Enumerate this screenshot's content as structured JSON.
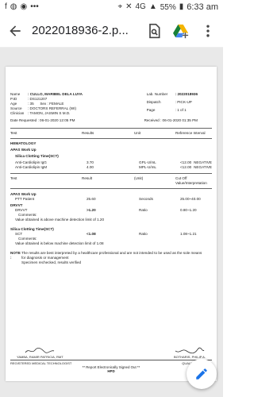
{
  "status_bar": {
    "battery": "55%",
    "network": "4G",
    "time": "6:33 am"
  },
  "app_bar": {
    "title": "2022018936-2.p..."
  },
  "report": {
    "header_left": {
      "name_label": "Name",
      "name_value": ": CULLO, MARIBEL DELA LUYA",
      "pid_label": "P.ID",
      "pid_value": ": DS121207",
      "age_label": "Age",
      "age_value": ": 35",
      "sex_label": "Sex",
      "sex_value": ": FEMALE",
      "source_label": "Source",
      "source_value": ": DOCTORS REFERRAL (WI)",
      "clinician_label": "Clinician",
      "clinician_value": ": TAMON, JASMIN S M.D.",
      "date_req_label": "Date Requested",
      "date_req_value": ": 06-01-2020 12:05 PM"
    },
    "header_right": {
      "lab_label": "Lab. Number",
      "lab_value": ": 2022018936",
      "dispatch_label": "Dispatch",
      "dispatch_value": ": PICK-UP",
      "page_label": "Page",
      "page_value": ": 1 of 1",
      "received_label": "Received",
      "received_value": ": 06-01-2020 01:35 PM"
    },
    "table1_headers": [
      "Test",
      "Results",
      "Unit",
      "Reference Interval"
    ],
    "section_hematology": "HEMATOLOGY",
    "section_apas": "APAS Work Up",
    "silica_title": "Silica Clotting Time(SCT)",
    "rows1": [
      {
        "test": "Anti-Cardiolipin IgG",
        "result": "3.70",
        "unit": "GPL-U/mL",
        "ref": "<12.00",
        "flag": "NEGATIVE"
      },
      {
        "test": "Anti-Cardiolipin IgM",
        "result": "4.00",
        "unit": "MPL-U/mL",
        "ref": "<12.00",
        "flag": "NEGATIVE"
      }
    ],
    "table2_headers": [
      "Test",
      "Result",
      "(Unit)",
      "Cut Off Value/Interpretation"
    ],
    "section_apas2": "APAS Work Up",
    "ptt": {
      "test": "PTT Patient",
      "result": "25.60",
      "unit": "Seconds",
      "ref": "25.00~40.00"
    },
    "drvvt_title": "DRVVT",
    "drvvt": {
      "test": "DRVVT",
      "result": ">1.20",
      "unit": "Ratio",
      "ref": "0.80~1.20"
    },
    "drvvt_comment_label": "Comments:",
    "drvvt_comment": "Value obtained is above machine detection limit of 1.20",
    "sct_title": "Silica Clotting Time(SCT)",
    "sct": {
      "test": "SCT",
      "result": "<1.08",
      "unit": "Ratio",
      "ref": "1.08~1.21"
    },
    "sct_comment_label": "Comments:",
    "sct_comment": "Value obtained is below machine detection limit of 1.08",
    "note_label": "NOTE :",
    "note_text_1": "The results are best interpreted by a healthcare professional and are not intended to be used as the sole means",
    "note_text_2": "for diagnosis or management",
    "note_text_3": "Specimen rechecked, results verified",
    "sig_left_name": "YAMBA, RAMIR PATRICIA, RMT",
    "sig_right_name": "BOTHARIS, PHILIP A.",
    "footer_left": "REGISTERED MEDICAL TECHNOLOGIST",
    "footer_right": "QUALITY CONTROL",
    "electronic": "** Report Electronically Signed Out **",
    "hpd": "HPD"
  },
  "icons": [
    "back-arrow-icon",
    "search-document-icon",
    "add-to-drive-icon",
    "more-vert-icon",
    "edit-pencil-icon"
  ],
  "colors": {
    "fab_icon": "#1a73e8",
    "drive_green": "#188038"
  }
}
